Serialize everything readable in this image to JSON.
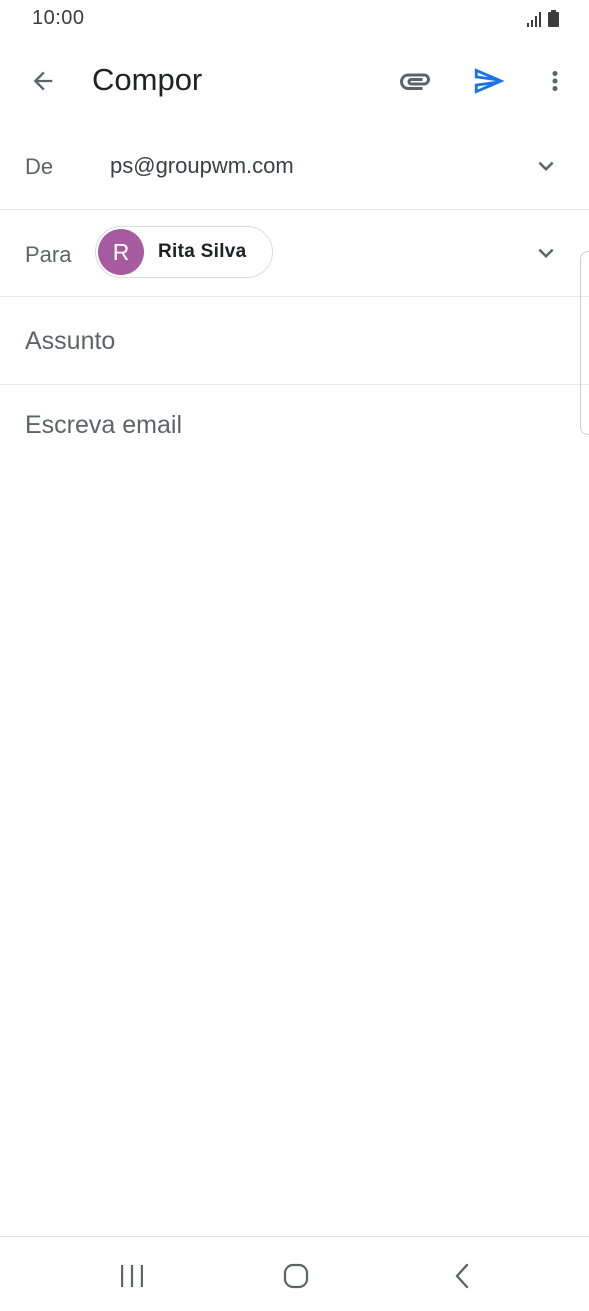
{
  "status_bar": {
    "time": "10:00",
    "icons": [
      "signal-icon",
      "battery-icon"
    ]
  },
  "app_bar": {
    "title": "Compor",
    "icons": [
      "back-arrow-icon",
      "paperclip-icon",
      "send-icon",
      "more-vert-icon"
    ]
  },
  "compose": {
    "from": {
      "label": "De",
      "value": "ps@groupwm.com"
    },
    "to": {
      "label": "Para",
      "recipients": [
        {
          "initial": "R",
          "name": "Rita Silva",
          "avatar_color": "#a65a9f"
        }
      ]
    },
    "subject": {
      "placeholder": "Assunto",
      "value": ""
    },
    "body": {
      "placeholder": "Escreva email",
      "value": ""
    }
  },
  "nav_bar": {
    "icons": [
      "recent-apps-icon",
      "home-icon",
      "back-icon"
    ]
  },
  "colors": {
    "accent": "#1a73e8",
    "icon_gray": "#5f6368",
    "divider": "#e8e8e8"
  }
}
